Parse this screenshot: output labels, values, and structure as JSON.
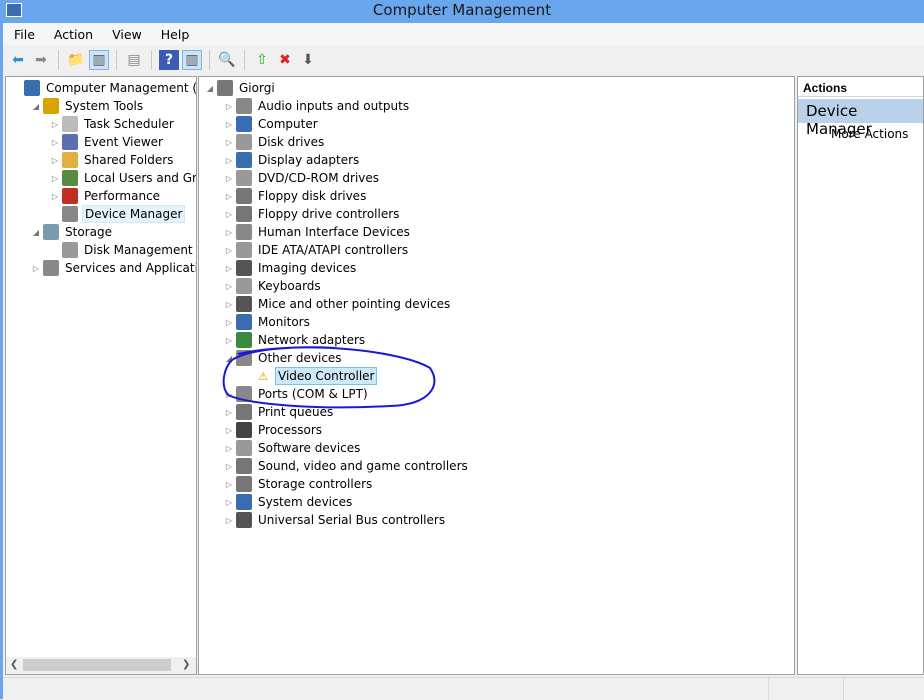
{
  "window": {
    "title": "Computer Management"
  },
  "menu": [
    "File",
    "Action",
    "View",
    "Help"
  ],
  "toolbar": [
    {
      "name": "back-icon",
      "glyph": "⬅",
      "color": "#2b8ee0"
    },
    {
      "name": "forward-icon",
      "glyph": "➡",
      "color": "#888"
    },
    {
      "sep": true
    },
    {
      "name": "up-folder-icon",
      "glyph": "📁",
      "color": "#d9a400"
    },
    {
      "name": "show-hide-console-tree-icon",
      "glyph": "▥",
      "color": "#555",
      "on": true
    },
    {
      "sep": true
    },
    {
      "name": "properties-icon",
      "glyph": "▤",
      "color": "#888"
    },
    {
      "sep": true
    },
    {
      "name": "help-icon",
      "glyph": "?",
      "color": "#fff",
      "bg": "#3b5bb5"
    },
    {
      "name": "show-hide-action-pane-icon",
      "glyph": "▥",
      "color": "#555",
      "on": true
    },
    {
      "sep": true
    },
    {
      "name": "scan-hardware-icon",
      "glyph": "🔍",
      "color": "#446"
    },
    {
      "sep": true
    },
    {
      "name": "update-driver-icon",
      "glyph": "⇧",
      "color": "#2a2"
    },
    {
      "name": "uninstall-device-icon",
      "glyph": "✖",
      "color": "#d22"
    },
    {
      "name": "disable-device-icon",
      "glyph": "⬇",
      "color": "#555"
    }
  ],
  "left_tree": [
    {
      "label": "Computer Management (Local",
      "level": 0,
      "arrow": "",
      "icon": "computer-icon",
      "color": "#3a6db0"
    },
    {
      "label": "System Tools",
      "level": 1,
      "arrow": "◢",
      "icon": "tools-icon",
      "color": "#d9a400"
    },
    {
      "label": "Task Scheduler",
      "level": 2,
      "arrow": "▷",
      "icon": "clock-icon",
      "color": "#bbb"
    },
    {
      "label": "Event Viewer",
      "level": 2,
      "arrow": "▷",
      "icon": "event-viewer-icon",
      "color": "#5a6fb0"
    },
    {
      "label": "Shared Folders",
      "level": 2,
      "arrow": "▷",
      "icon": "shared-folder-icon",
      "color": "#e0b040"
    },
    {
      "label": "Local Users and Groups",
      "level": 2,
      "arrow": "▷",
      "icon": "users-icon",
      "color": "#5a8a40"
    },
    {
      "label": "Performance",
      "level": 2,
      "arrow": "▷",
      "icon": "performance-icon",
      "color": "#c03020"
    },
    {
      "label": "Device Manager",
      "level": 2,
      "arrow": "",
      "icon": "device-manager-icon",
      "color": "#888",
      "selected": true
    },
    {
      "label": "Storage",
      "level": 1,
      "arrow": "◢",
      "icon": "storage-icon",
      "color": "#7a9ab0"
    },
    {
      "label": "Disk Management",
      "level": 2,
      "arrow": "",
      "icon": "disk-icon",
      "color": "#999"
    },
    {
      "label": "Services and Applications",
      "level": 1,
      "arrow": "▷",
      "icon": "services-icon",
      "color": "#888"
    }
  ],
  "device_tree": [
    {
      "label": "Giorgi",
      "level": 0,
      "arrow": "◢",
      "icon": "computer-icon",
      "color": "#777"
    },
    {
      "label": "Audio inputs and outputs",
      "level": 1,
      "arrow": "▷",
      "icon": "speaker-icon",
      "color": "#888"
    },
    {
      "label": "Computer",
      "level": 1,
      "arrow": "▷",
      "icon": "computer-icon",
      "color": "#3a6db0"
    },
    {
      "label": "Disk drives",
      "level": 1,
      "arrow": "▷",
      "icon": "disk-drive-icon",
      "color": "#999"
    },
    {
      "label": "Display adapters",
      "level": 1,
      "arrow": "▷",
      "icon": "display-adapter-icon",
      "color": "#3a6db0"
    },
    {
      "label": "DVD/CD-ROM drives",
      "level": 1,
      "arrow": "▷",
      "icon": "dvd-icon",
      "color": "#999"
    },
    {
      "label": "Floppy disk drives",
      "level": 1,
      "arrow": "▷",
      "icon": "floppy-icon",
      "color": "#777"
    },
    {
      "label": "Floppy drive controllers",
      "level": 1,
      "arrow": "▷",
      "icon": "floppy-controller-icon",
      "color": "#777"
    },
    {
      "label": "Human Interface Devices",
      "level": 1,
      "arrow": "▷",
      "icon": "hid-icon",
      "color": "#888"
    },
    {
      "label": "IDE ATA/ATAPI controllers",
      "level": 1,
      "arrow": "▷",
      "icon": "ide-icon",
      "color": "#999"
    },
    {
      "label": "Imaging devices",
      "level": 1,
      "arrow": "▷",
      "icon": "camera-icon",
      "color": "#555"
    },
    {
      "label": "Keyboards",
      "level": 1,
      "arrow": "▷",
      "icon": "keyboard-icon",
      "color": "#999"
    },
    {
      "label": "Mice and other pointing devices",
      "level": 1,
      "arrow": "▷",
      "icon": "mouse-icon",
      "color": "#555"
    },
    {
      "label": "Monitors",
      "level": 1,
      "arrow": "▷",
      "icon": "monitor-icon",
      "color": "#3a6db0"
    },
    {
      "label": "Network adapters",
      "level": 1,
      "arrow": "▷",
      "icon": "network-icon",
      "color": "#3a8a40"
    },
    {
      "label": "Other devices",
      "level": 1,
      "arrow": "◢",
      "icon": "unknown-device-icon",
      "color": "#888"
    },
    {
      "label": "Video Controller",
      "level": 2,
      "arrow": "",
      "icon": "warning-device-icon",
      "color": "#e8c000",
      "selected": true
    },
    {
      "label": "Ports (COM & LPT)",
      "level": 1,
      "arrow": "▷",
      "icon": "port-icon",
      "color": "#888"
    },
    {
      "label": "Print queues",
      "level": 1,
      "arrow": "▷",
      "icon": "printer-icon",
      "color": "#777"
    },
    {
      "label": "Processors",
      "level": 1,
      "arrow": "▷",
      "icon": "processor-icon",
      "color": "#444"
    },
    {
      "label": "Software devices",
      "level": 1,
      "arrow": "▷",
      "icon": "software-device-icon",
      "color": "#999"
    },
    {
      "label": "Sound, video and game controllers",
      "level": 1,
      "arrow": "▷",
      "icon": "sound-icon",
      "color": "#777"
    },
    {
      "label": "Storage controllers",
      "level": 1,
      "arrow": "▷",
      "icon": "storage-controller-icon",
      "color": "#777"
    },
    {
      "label": "System devices",
      "level": 1,
      "arrow": "▷",
      "icon": "system-device-icon",
      "color": "#3a6db0"
    },
    {
      "label": "Universal Serial Bus controllers",
      "level": 1,
      "arrow": "▷",
      "icon": "usb-icon",
      "color": "#555"
    }
  ],
  "actions": {
    "header": "Actions",
    "section": "Device Manager",
    "more": "More Actions"
  },
  "annotation_color": "#1a1ad0"
}
